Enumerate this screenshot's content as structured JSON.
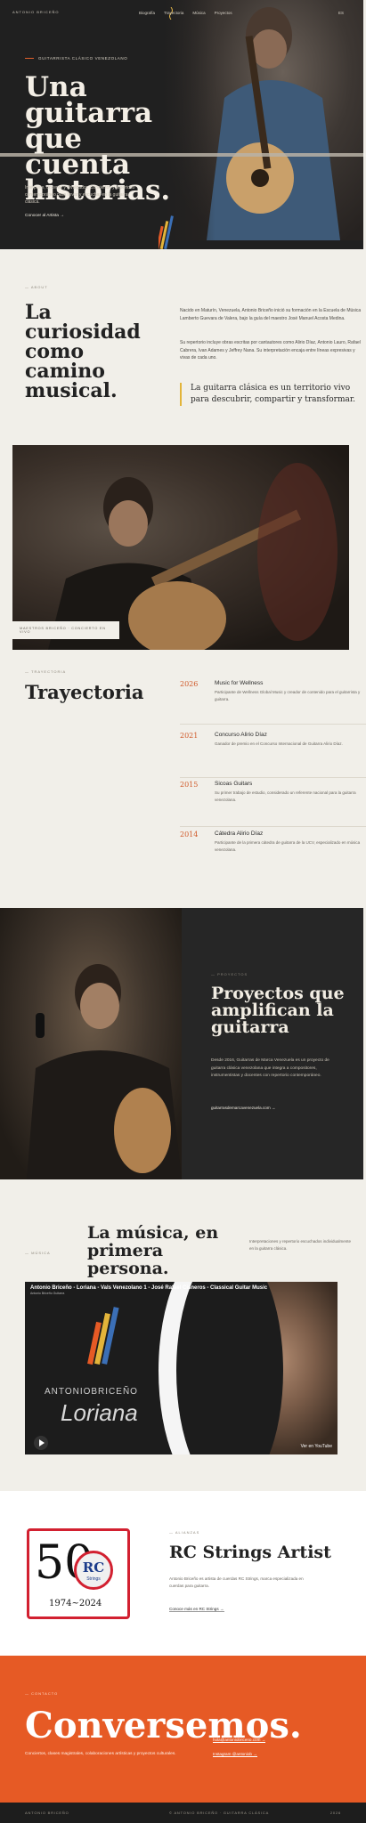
{
  "nav": {
    "brand": "ANTONIO BRICEÑO",
    "links": [
      "Biografía",
      "Trayectoria",
      "Música",
      "Proyectos"
    ],
    "lang": "ES"
  },
  "hero": {
    "eyebrow": "GUITARRISTA CLÁSICO VENEZOLANO",
    "title": "Una guitarra que cuenta historias.",
    "description": "Intérprete, docente y divulgador. Conciertos y repertorio contemporáneo para llevar y escuchar en la guitarra clásica.",
    "cta": "Conocer al Artista →"
  },
  "about": {
    "eyebrow": "— ABOUT",
    "title": "La curiosidad como camino musical.",
    "p1": "Nacido en Maturín, Venezuela, Antonio Briceño inició su formación en la Escuela de Música Lamberto Guevara de Valera, bajo la guía del maestro José Manuel Acosta Medina.",
    "p2": "Su repertorio incluye obras escritas por cantautores como Alirio Díaz, Antonio Lauro, Rafael Cabrera, Ivan Adames y Jeffrey Nana. Su interpretación encaja entre líneas expresivas y vivas de cada uno.",
    "quote": "La guitarra clásica es un territorio vivo para descubrir, compartir y transformar."
  },
  "photo2": {
    "caption": "MAESTROS BRICEÑO · CONCIERTO EN VIVO"
  },
  "trajectory": {
    "eyebrow": "— TRAYECTORIA",
    "title": "Trayectoria",
    "items": [
      {
        "year": "2026",
        "name": "Music for Wellness",
        "desc": "Participante de Wellness Global Music y creador de contenido para el guitarrista y guitarra."
      },
      {
        "year": "2021",
        "name": "Concurso Alirio Díaz",
        "desc": "Ganador de premio en el Concurso Internacional de Guitarra Alirio Díaz."
      },
      {
        "year": "2015",
        "name": "Sicoas Guitars",
        "desc": "Su primer trabajo de estudio, considerado un referente nacional para la guitarra venezolana."
      },
      {
        "year": "2014",
        "name": "Cátedra Alirio Díaz",
        "desc": "Participante de la primera cátedra de guitarra de la UCV, especializado en música venezolana."
      }
    ]
  },
  "projects": {
    "eyebrow": "— PROYECTOS",
    "title": "Proyectos que amplifican la guitarra",
    "description": "Desde 2016, Guitarras de Marca Venezuela es un proyecto de guitarra clásica venezolana que integra a compositores, instrumentistas y docentes con repertorio contemporáneo.",
    "link": "guitarrasdemarcavenezuela.com →"
  },
  "music": {
    "eyebrow": "— MÚSICA",
    "title": "La música, en primera persona.",
    "side": "Interpretaciones y repertorio escuchados individualmente en la guitarra clásica.",
    "video_title": "Antonio Briceño - Loriana - Vals Venezolano 1 - José Rafael Cisneros - Classical Guitar Music",
    "video_sub": "Antonio Briceño Guitarra",
    "video_name": "ANTONIOBRICEÑO",
    "video_album": "Loriana",
    "video_brand": "Ver en YouTube"
  },
  "rc": {
    "eyebrow": "— ALIANZAS",
    "title": "RC Strings Artist",
    "desc": "Antonio Briceño es artista de cuerdas RC Strings, marca especializada en cuerdas para guitarra.",
    "link": "Conoce más en RC Strings →",
    "logo_years": "1974~2024",
    "logo_number": "50",
    "logo_rc": "RC",
    "logo_strings": "Strings"
  },
  "contact": {
    "eyebrow": "— CONTACTO",
    "title": "Conversemos.",
    "desc": "Conciertos, clases magistrales, colaboraciones artísticas y proyectos culturales.",
    "email": "hola@antoniobriceno.com →",
    "instagram": "Instagram @antoniob →"
  },
  "footer": {
    "left": "ANTONIO BRICEÑO",
    "center": "© ANTONIO BRICEÑO · GUITARRA CLÁSICA",
    "right": "2026"
  },
  "colors": {
    "accent": "#e65a25",
    "dark": "#202020",
    "quote_bar": "#e3b43a",
    "rc_red": "#d22030"
  }
}
